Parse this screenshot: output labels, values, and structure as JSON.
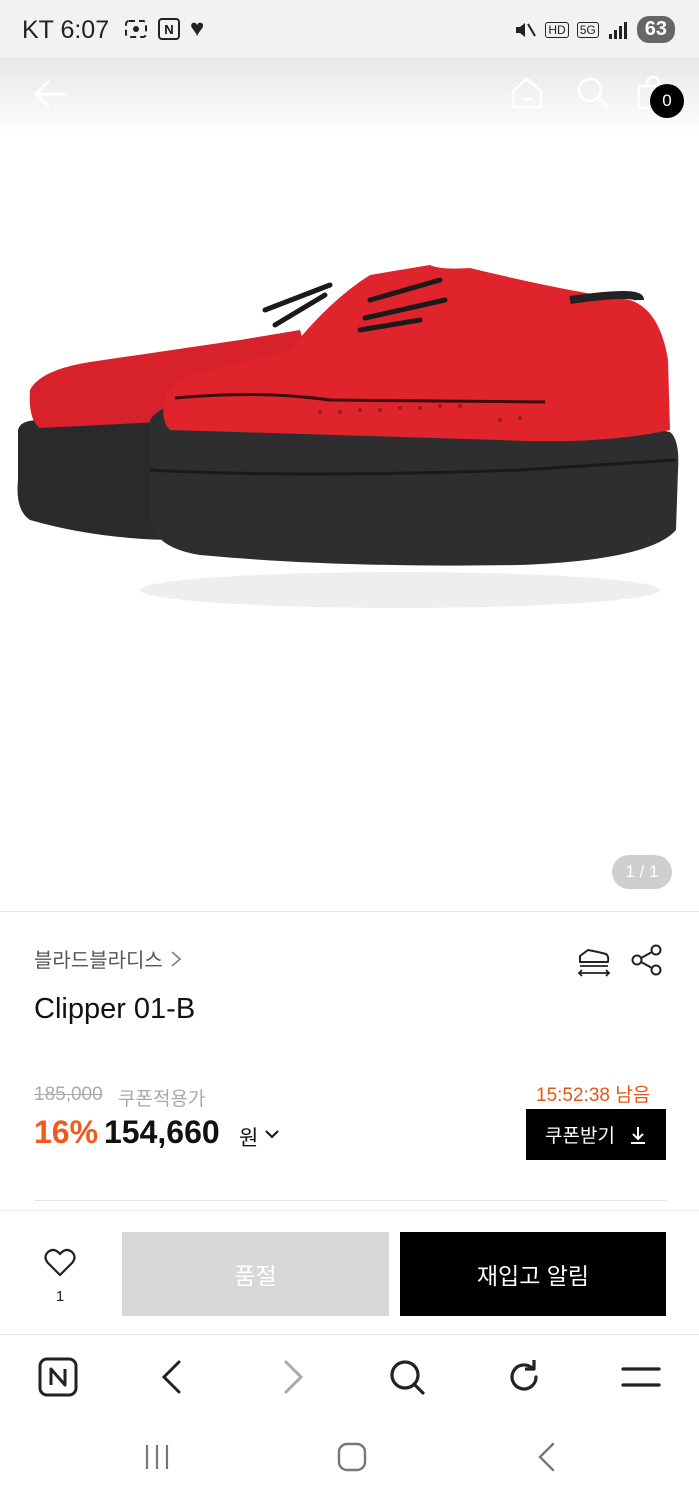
{
  "status_bar": {
    "carrier": "KT",
    "time": "6:07",
    "naver_badge": "N",
    "hd_label": "HD",
    "network": "5G",
    "battery": "63"
  },
  "header": {
    "cart_count": "0"
  },
  "gallery": {
    "indicator": "1 / 1"
  },
  "product": {
    "brand": "블라드블라디스",
    "name": "Clipper 01-B",
    "original_price": "185,000",
    "coupon_price_label": "쿠폰적용가",
    "discount": "16%",
    "price": "154,660",
    "currency": "원",
    "time_left": "15:52:38 남음",
    "coupon_button": "쿠폰받기"
  },
  "actions": {
    "like_count": "1",
    "soldout_label": "품절",
    "restock_label": "재입고 알림"
  },
  "browser_toolbar": {
    "naver_label": "N"
  },
  "colors": {
    "accent": "#f05a1a",
    "shoe": "#e0242c",
    "sole": "#2a2a2d"
  }
}
